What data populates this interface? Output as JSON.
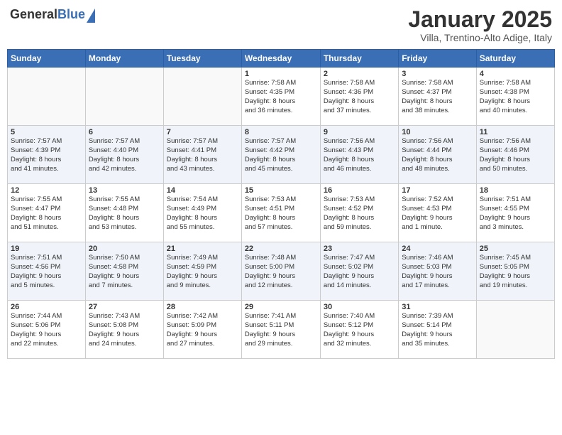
{
  "logo": {
    "general": "General",
    "blue": "Blue"
  },
  "title": "January 2025",
  "subtitle": "Villa, Trentino-Alto Adige, Italy",
  "weekdays": [
    "Sunday",
    "Monday",
    "Tuesday",
    "Wednesday",
    "Thursday",
    "Friday",
    "Saturday"
  ],
  "weeks": [
    [
      {
        "day": "",
        "info": ""
      },
      {
        "day": "",
        "info": ""
      },
      {
        "day": "",
        "info": ""
      },
      {
        "day": "1",
        "info": "Sunrise: 7:58 AM\nSunset: 4:35 PM\nDaylight: 8 hours\nand 36 minutes."
      },
      {
        "day": "2",
        "info": "Sunrise: 7:58 AM\nSunset: 4:36 PM\nDaylight: 8 hours\nand 37 minutes."
      },
      {
        "day": "3",
        "info": "Sunrise: 7:58 AM\nSunset: 4:37 PM\nDaylight: 8 hours\nand 38 minutes."
      },
      {
        "day": "4",
        "info": "Sunrise: 7:58 AM\nSunset: 4:38 PM\nDaylight: 8 hours\nand 40 minutes."
      }
    ],
    [
      {
        "day": "5",
        "info": "Sunrise: 7:57 AM\nSunset: 4:39 PM\nDaylight: 8 hours\nand 41 minutes."
      },
      {
        "day": "6",
        "info": "Sunrise: 7:57 AM\nSunset: 4:40 PM\nDaylight: 8 hours\nand 42 minutes."
      },
      {
        "day": "7",
        "info": "Sunrise: 7:57 AM\nSunset: 4:41 PM\nDaylight: 8 hours\nand 43 minutes."
      },
      {
        "day": "8",
        "info": "Sunrise: 7:57 AM\nSunset: 4:42 PM\nDaylight: 8 hours\nand 45 minutes."
      },
      {
        "day": "9",
        "info": "Sunrise: 7:56 AM\nSunset: 4:43 PM\nDaylight: 8 hours\nand 46 minutes."
      },
      {
        "day": "10",
        "info": "Sunrise: 7:56 AM\nSunset: 4:44 PM\nDaylight: 8 hours\nand 48 minutes."
      },
      {
        "day": "11",
        "info": "Sunrise: 7:56 AM\nSunset: 4:46 PM\nDaylight: 8 hours\nand 50 minutes."
      }
    ],
    [
      {
        "day": "12",
        "info": "Sunrise: 7:55 AM\nSunset: 4:47 PM\nDaylight: 8 hours\nand 51 minutes."
      },
      {
        "day": "13",
        "info": "Sunrise: 7:55 AM\nSunset: 4:48 PM\nDaylight: 8 hours\nand 53 minutes."
      },
      {
        "day": "14",
        "info": "Sunrise: 7:54 AM\nSunset: 4:49 PM\nDaylight: 8 hours\nand 55 minutes."
      },
      {
        "day": "15",
        "info": "Sunrise: 7:53 AM\nSunset: 4:51 PM\nDaylight: 8 hours\nand 57 minutes."
      },
      {
        "day": "16",
        "info": "Sunrise: 7:53 AM\nSunset: 4:52 PM\nDaylight: 8 hours\nand 59 minutes."
      },
      {
        "day": "17",
        "info": "Sunrise: 7:52 AM\nSunset: 4:53 PM\nDaylight: 9 hours\nand 1 minute."
      },
      {
        "day": "18",
        "info": "Sunrise: 7:51 AM\nSunset: 4:55 PM\nDaylight: 9 hours\nand 3 minutes."
      }
    ],
    [
      {
        "day": "19",
        "info": "Sunrise: 7:51 AM\nSunset: 4:56 PM\nDaylight: 9 hours\nand 5 minutes."
      },
      {
        "day": "20",
        "info": "Sunrise: 7:50 AM\nSunset: 4:58 PM\nDaylight: 9 hours\nand 7 minutes."
      },
      {
        "day": "21",
        "info": "Sunrise: 7:49 AM\nSunset: 4:59 PM\nDaylight: 9 hours\nand 9 minutes."
      },
      {
        "day": "22",
        "info": "Sunrise: 7:48 AM\nSunset: 5:00 PM\nDaylight: 9 hours\nand 12 minutes."
      },
      {
        "day": "23",
        "info": "Sunrise: 7:47 AM\nSunset: 5:02 PM\nDaylight: 9 hours\nand 14 minutes."
      },
      {
        "day": "24",
        "info": "Sunrise: 7:46 AM\nSunset: 5:03 PM\nDaylight: 9 hours\nand 17 minutes."
      },
      {
        "day": "25",
        "info": "Sunrise: 7:45 AM\nSunset: 5:05 PM\nDaylight: 9 hours\nand 19 minutes."
      }
    ],
    [
      {
        "day": "26",
        "info": "Sunrise: 7:44 AM\nSunset: 5:06 PM\nDaylight: 9 hours\nand 22 minutes."
      },
      {
        "day": "27",
        "info": "Sunrise: 7:43 AM\nSunset: 5:08 PM\nDaylight: 9 hours\nand 24 minutes."
      },
      {
        "day": "28",
        "info": "Sunrise: 7:42 AM\nSunset: 5:09 PM\nDaylight: 9 hours\nand 27 minutes."
      },
      {
        "day": "29",
        "info": "Sunrise: 7:41 AM\nSunset: 5:11 PM\nDaylight: 9 hours\nand 29 minutes."
      },
      {
        "day": "30",
        "info": "Sunrise: 7:40 AM\nSunset: 5:12 PM\nDaylight: 9 hours\nand 32 minutes."
      },
      {
        "day": "31",
        "info": "Sunrise: 7:39 AM\nSunset: 5:14 PM\nDaylight: 9 hours\nand 35 minutes."
      },
      {
        "day": "",
        "info": ""
      }
    ]
  ]
}
